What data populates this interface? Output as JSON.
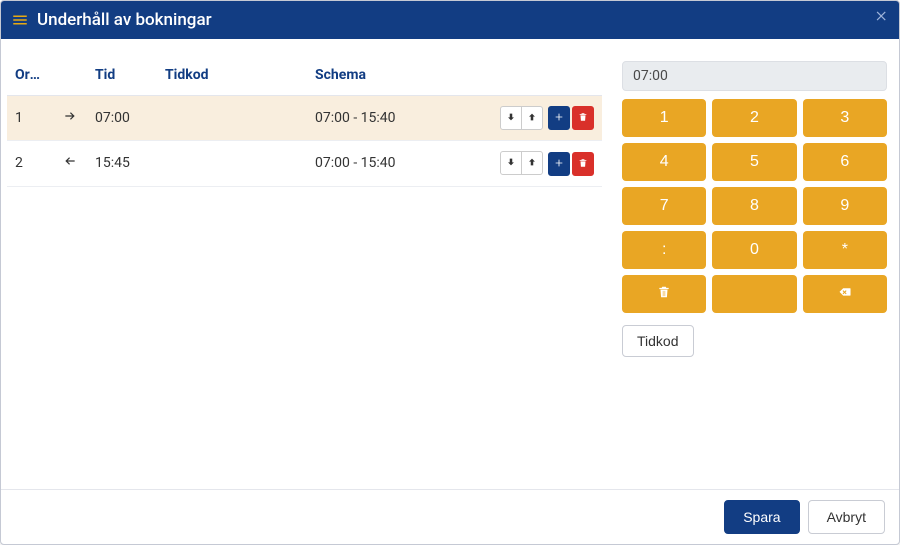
{
  "window": {
    "title": "Underhåll av bokningar"
  },
  "table": {
    "columns": {
      "order": "Ordning",
      "tid": "Tid",
      "tidkod": "Tidkod",
      "schema": "Schema"
    },
    "rows": [
      {
        "order": "1",
        "direction": "right",
        "tid": "07:00",
        "tidkod": "",
        "schema": "07:00 - 15:40",
        "active": true
      },
      {
        "order": "2",
        "direction": "left",
        "tid": "15:45",
        "tidkod": "",
        "schema": "07:00 - 15:40",
        "active": false
      }
    ]
  },
  "input": {
    "display_value": "07:00"
  },
  "keypad": {
    "k1": "1",
    "k2": "2",
    "k3": "3",
    "k4": "4",
    "k5": "5",
    "k6": "6",
    "k7": "7",
    "k8": "8",
    "k9": "9",
    "kcolon": ":",
    "k0": "0",
    "kstar": "*"
  },
  "buttons": {
    "tidkod": "Tidkod",
    "save": "Spara",
    "cancel": "Avbryt"
  }
}
